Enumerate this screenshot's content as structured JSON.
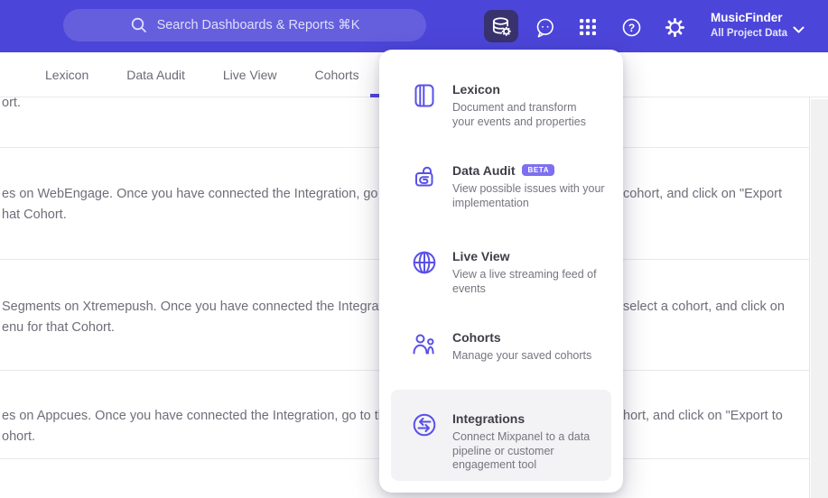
{
  "colors": {
    "header_bg": "#4c45d9",
    "header_active_bg": "#38326f",
    "accent": "#4f44e0",
    "menu_icon": "#5950e8",
    "badge_bg": "#7e6ff0",
    "row_divider": "#e8e8ec",
    "text_muted": "#6e6e79",
    "menu_title": "#3e3e48",
    "menu_desc": "#75757f",
    "highlight_bg": "#f3f3f5",
    "side_strip": "#f1f1f2"
  },
  "header": {
    "search_placeholder": "Search Dashboards & Reports ⌘K",
    "project_name": "MusicFinder",
    "project_subtitle": "All Project Data",
    "help_glyph": "?"
  },
  "tabs": [
    "Lexicon",
    "Data Audit",
    "Live View",
    "Cohorts"
  ],
  "menu_items": [
    {
      "title": "Lexicon",
      "desc": "Document and transform\nyour events and properties"
    },
    {
      "title": "Data Audit",
      "badge": "BETA",
      "desc": "View possible issues with your\nimplementation"
    },
    {
      "title": "Live View",
      "desc": "View a live streaming feed of\nevents"
    },
    {
      "title": "Cohorts",
      "desc": "Manage your saved cohorts"
    },
    {
      "title": "Integrations",
      "desc": "Connect Mixpanel to a data\npipeline or customer\nengagement tool"
    }
  ],
  "content_rows": [
    {
      "line2": "ort."
    },
    {
      "line1_left": "es on WebEngage. Once you have connected the Integration, go to the",
      "line1_right": "cohort, and click on \"Export",
      "line2": "hat Cohort."
    },
    {
      "line1_left": "Segments on Xtremepush. Once you have connected the Integration, ",
      "line1_right": "select a cohort, and click on",
      "line2": "enu for that Cohort."
    },
    {
      "line1_left": "es on Appcues. Once you have connected the Integration, go to the M",
      "line1_right": "hort, and click on \"Export to",
      "line2": "ohort."
    }
  ]
}
